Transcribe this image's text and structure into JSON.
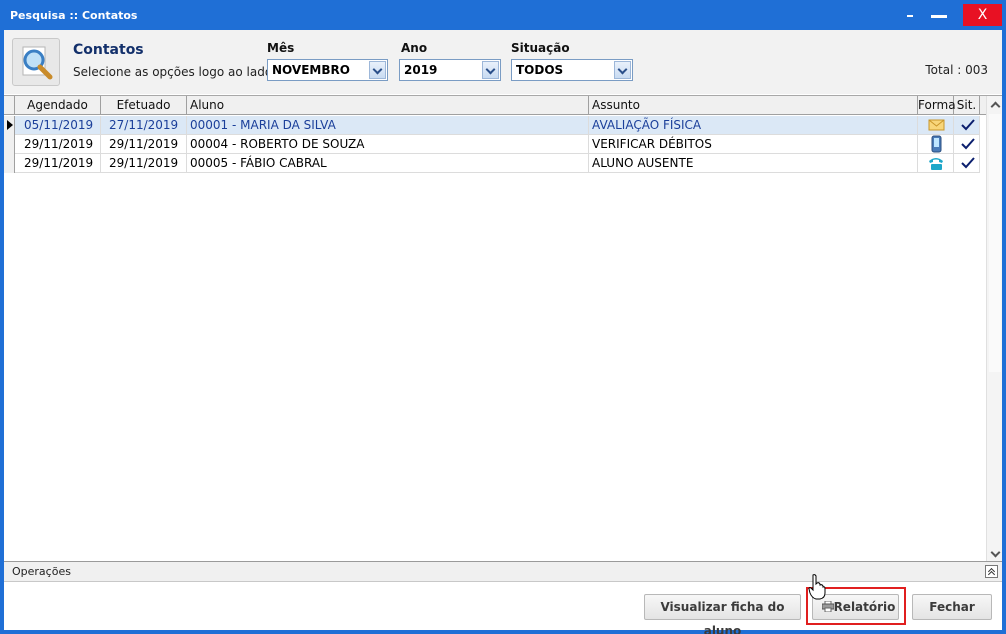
{
  "window": {
    "title": "Pesquisa :: Contatos",
    "close_label": "X"
  },
  "header": {
    "title": "Contatos",
    "subtitle": "Selecione as opções logo ao lado",
    "icon": "search-magnifier-icon"
  },
  "filters": {
    "mes": {
      "label": "Mês",
      "value": "NOVEMBRO"
    },
    "ano": {
      "label": "Ano",
      "value": "2019"
    },
    "situacao": {
      "label": "Situação",
      "value": "TODOS"
    }
  },
  "total": "Total : 003",
  "grid": {
    "columns": [
      "Agendado",
      "Efetuado",
      "Aluno",
      "Assunto",
      "Forma",
      "Sit."
    ],
    "rows": [
      {
        "agendado": "05/11/2019",
        "efetuado": "27/11/2019",
        "aluno": "00001 - MARIA DA SILVA",
        "assunto": "AVALIAÇÃO FÍSICA",
        "forma_icon": "email-icon",
        "sit_icon": "checkmark-icon",
        "selected": true
      },
      {
        "agendado": "29/11/2019",
        "efetuado": "29/11/2019",
        "aluno": "00004 - ROBERTO DE SOUZA",
        "assunto": "VERIFICAR DÉBITOS",
        "forma_icon": "mobile-phone-icon",
        "sit_icon": "checkmark-icon",
        "selected": false
      },
      {
        "agendado": "29/11/2019",
        "efetuado": "29/11/2019",
        "aluno": "00005 - FÁBIO CABRAL",
        "assunto": "ALUNO AUSENTE",
        "forma_icon": "telephone-icon",
        "sit_icon": "checkmark-icon",
        "selected": false
      }
    ]
  },
  "operations": {
    "label": "Operações"
  },
  "buttons": {
    "ficha": "Visualizar ficha do aluno",
    "relatorio": "Relatório",
    "fechar": "Fechar"
  },
  "colors": {
    "window_blue": "#1f6fd6",
    "title_navy": "#13306b",
    "selected_row": "#dbe8f6",
    "highlight_red": "#e01f1f"
  }
}
